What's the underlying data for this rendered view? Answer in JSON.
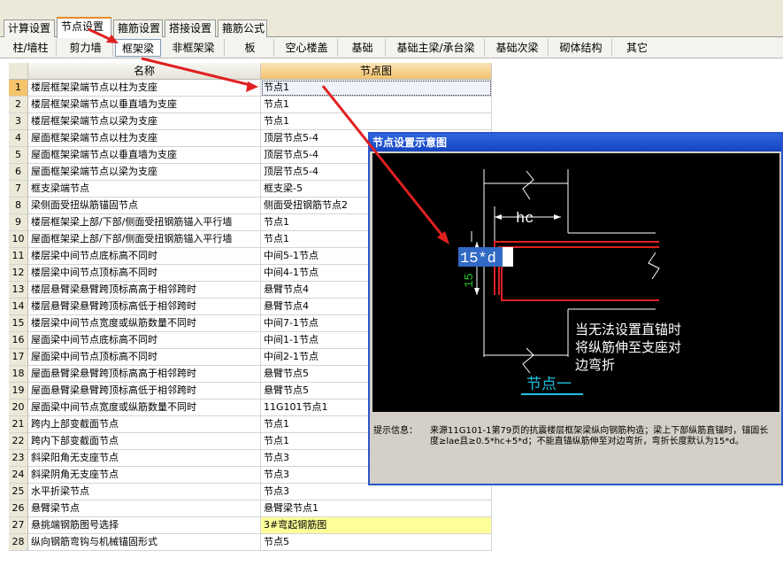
{
  "top_tabs": [
    "计算设置",
    "节点设置",
    "箍筋设置",
    "搭接设置",
    "箍筋公式"
  ],
  "sub_tabs": [
    "柱/墙柱",
    "剪力墙",
    "框架梁",
    "非框架梁",
    "板",
    "空心楼盖",
    "基础",
    "基础主梁/承台梁",
    "基础次梁",
    "砌体结构",
    "其它"
  ],
  "grid": {
    "headers": {
      "name": "名称",
      "node": "节点图"
    },
    "rows": [
      {
        "num": "1",
        "name": "楼层框架梁端节点以柱为支座",
        "node": "节点1"
      },
      {
        "num": "2",
        "name": "楼层框架梁端节点以垂直墙为支座",
        "node": "节点1"
      },
      {
        "num": "3",
        "name": "楼层框架梁端节点以梁为支座",
        "node": "节点1"
      },
      {
        "num": "4",
        "name": "屋面框架梁端节点以柱为支座",
        "node": "顶层节点5-4"
      },
      {
        "num": "5",
        "name": "屋面框架梁端节点以垂直墙为支座",
        "node": "顶层节点5-4"
      },
      {
        "num": "6",
        "name": "屋面框架梁端节点以梁为支座",
        "node": "顶层节点5-4"
      },
      {
        "num": "7",
        "name": "框支梁端节点",
        "node": "框支梁-5"
      },
      {
        "num": "8",
        "name": "梁侧面受扭纵筋锚固节点",
        "node": "侧面受扭钢筋节点2"
      },
      {
        "num": "9",
        "name": "楼层框架梁上部/下部/侧面受扭钢筋锚入平行墙",
        "node": "节点1"
      },
      {
        "num": "10",
        "name": "屋面框架梁上部/下部/侧面受扭钢筋锚入平行墙",
        "node": "节点1"
      },
      {
        "num": "11",
        "name": "楼层梁中间节点底标高不同时",
        "node": "中间5-1节点"
      },
      {
        "num": "12",
        "name": "楼层梁中间节点顶标高不同时",
        "node": "中间4-1节点"
      },
      {
        "num": "13",
        "name": "楼层悬臂梁悬臂跨顶标高高于相邻跨时",
        "node": "悬臂节点4"
      },
      {
        "num": "14",
        "name": "楼层悬臂梁悬臂跨顶标高低于相邻跨时",
        "node": "悬臂节点4"
      },
      {
        "num": "15",
        "name": "楼层梁中间节点宽度或纵筋数量不同时",
        "node": "中间7-1节点"
      },
      {
        "num": "16",
        "name": "屋面梁中间节点底标高不同时",
        "node": "中间1-1节点"
      },
      {
        "num": "17",
        "name": "屋面梁中间节点顶标高不同时",
        "node": "中间2-1节点"
      },
      {
        "num": "18",
        "name": "屋面悬臂梁悬臂跨顶标高高于相邻跨时",
        "node": "悬臂节点5"
      },
      {
        "num": "19",
        "name": "屋面悬臂梁悬臂跨顶标高低于相邻跨时",
        "node": "悬臂节点5"
      },
      {
        "num": "20",
        "name": "屋面梁中间节点宽度或纵筋数量不同时",
        "node": "11G101节点1"
      },
      {
        "num": "21",
        "name": "跨内上部变截面节点",
        "node": "节点1"
      },
      {
        "num": "22",
        "name": "跨内下部变截面节点",
        "node": "节点1"
      },
      {
        "num": "23",
        "name": "斜梁阳角无支座节点",
        "node": "节点3"
      },
      {
        "num": "24",
        "name": "斜梁阴角无支座节点",
        "node": "节点3"
      },
      {
        "num": "25",
        "name": "水平折梁节点",
        "node": "节点3"
      },
      {
        "num": "26",
        "name": "悬臂梁节点",
        "node": "悬臂梁节点1"
      },
      {
        "num": "27",
        "name": "悬挑端钢筋图号选择",
        "node": "3#弯起钢筋图"
      },
      {
        "num": "28",
        "name": "纵向钢筋弯钩与机械锚固形式",
        "node": "节点5"
      }
    ]
  },
  "dialog": {
    "title": "节点设置示意图",
    "diagram": {
      "dim_hc": "hc",
      "anchor_value": "15*d",
      "dim_15": "15",
      "note_lines": [
        "当无法设置直锚时",
        "将纵筋伸至支座对",
        "边弯折"
      ],
      "caption": "节点一"
    },
    "info_label": "提示信息：",
    "info_text": "来源11G101-1第79页的抗震楼层框架梁纵向钢筋构造；梁上下部纵筋直锚时，锚固长度≥lae且≥0.5*hc+5*d；不能直锚纵筋伸至对边弯折，弯折长度默认为15*d。"
  },
  "colors": {
    "accent_red": "#e02020",
    "selection": "#316ac5",
    "diagram_green": "#20c020",
    "caption_cyan": "#20c0e0"
  }
}
